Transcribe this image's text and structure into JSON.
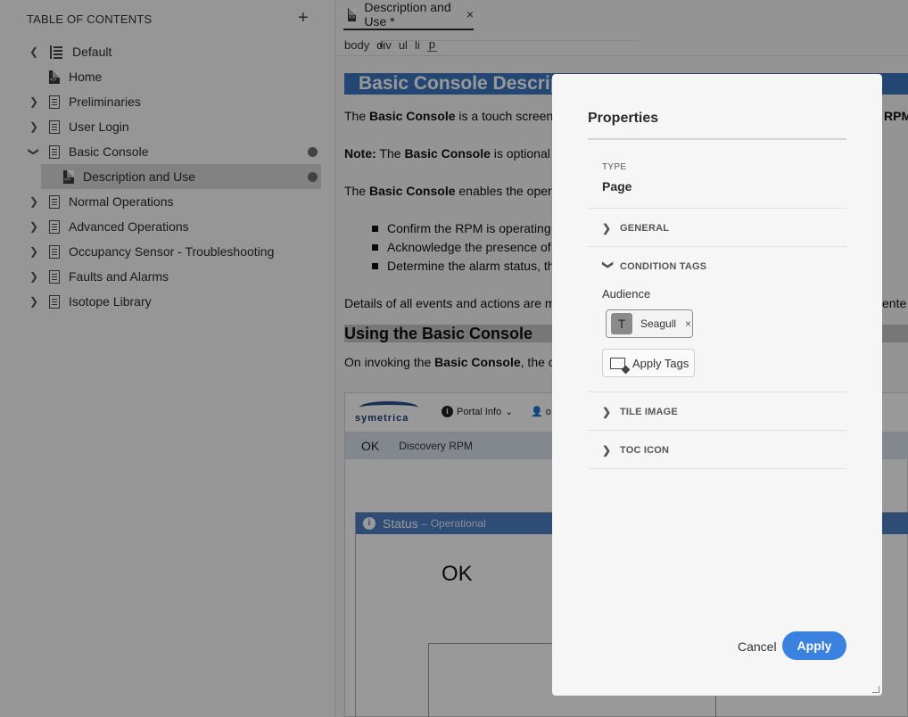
{
  "sidebar": {
    "header": "TABLE OF CONTENTS",
    "add_icon": "+",
    "items": [
      {
        "label": "Default",
        "icon": "tree-icon"
      },
      {
        "label": "Home",
        "icon": "doc-icon"
      },
      {
        "label": "Preliminaries",
        "icon": "page-icon"
      },
      {
        "label": "User Login",
        "icon": "page-icon"
      },
      {
        "label": "Basic Console",
        "icon": "page-icon"
      },
      {
        "label": "Description and Use",
        "icon": "doc-icon"
      },
      {
        "label": "Normal Operations",
        "icon": "page-icon"
      },
      {
        "label": "Advanced Operations",
        "icon": "page-icon"
      },
      {
        "label": "Occupancy Sensor - Troubleshooting",
        "icon": "page-icon"
      },
      {
        "label": "Faults and Alarms",
        "icon": "page-icon"
      },
      {
        "label": "Isotope Library",
        "icon": "page-icon"
      }
    ]
  },
  "editor": {
    "tab_label": "Description and Use *",
    "tab_close": "×",
    "breadcrumb": [
      "body",
      "div",
      "ul",
      "li",
      "p"
    ],
    "breadcrumb_sep": "▸",
    "h1": "Basic Console Descript",
    "p1": {
      "pre": "The ",
      "bold": "Basic Console",
      "post": " is a touch screen",
      "tail": "RPM"
    },
    "note": {
      "label": "Note:",
      "pre": " The ",
      "bold": "Basic Console",
      "post": " is optional"
    },
    "p2": {
      "pre": "The ",
      "bold": "Basic Console",
      "post": " enables the oper"
    },
    "bullets": [
      "Confirm the RPM is operating",
      "Acknowledge the presence of",
      "Determine the alarm status, th"
    ],
    "p3": {
      "text": "Details of all events and actions are m",
      "tail": "ente"
    },
    "h2": "Using the Basic Console",
    "p4": {
      "pre": "On invoking the ",
      "bold": "Basic Console",
      "post": ", the c"
    },
    "screenshot": {
      "logo": "symetrica",
      "portal": "Portal Info",
      "user": "o",
      "ok": "OK",
      "rpm": "Discovery RPM",
      "status_title": "Status",
      "status_sub": "– Operational",
      "big_ok": "OK"
    }
  },
  "dialog": {
    "title": "Properties",
    "type_label": "TYPE",
    "type_value": "Page",
    "sections": [
      "GENERAL",
      "CONDITION TAGS",
      "TILE IMAGE",
      "TOC ICON"
    ],
    "audience_label": "Audience",
    "tag": {
      "initial": "T",
      "name": "Seagull",
      "remove": "×"
    },
    "apply_tags": "Apply Tags",
    "cancel": "Cancel",
    "apply": "Apply"
  }
}
